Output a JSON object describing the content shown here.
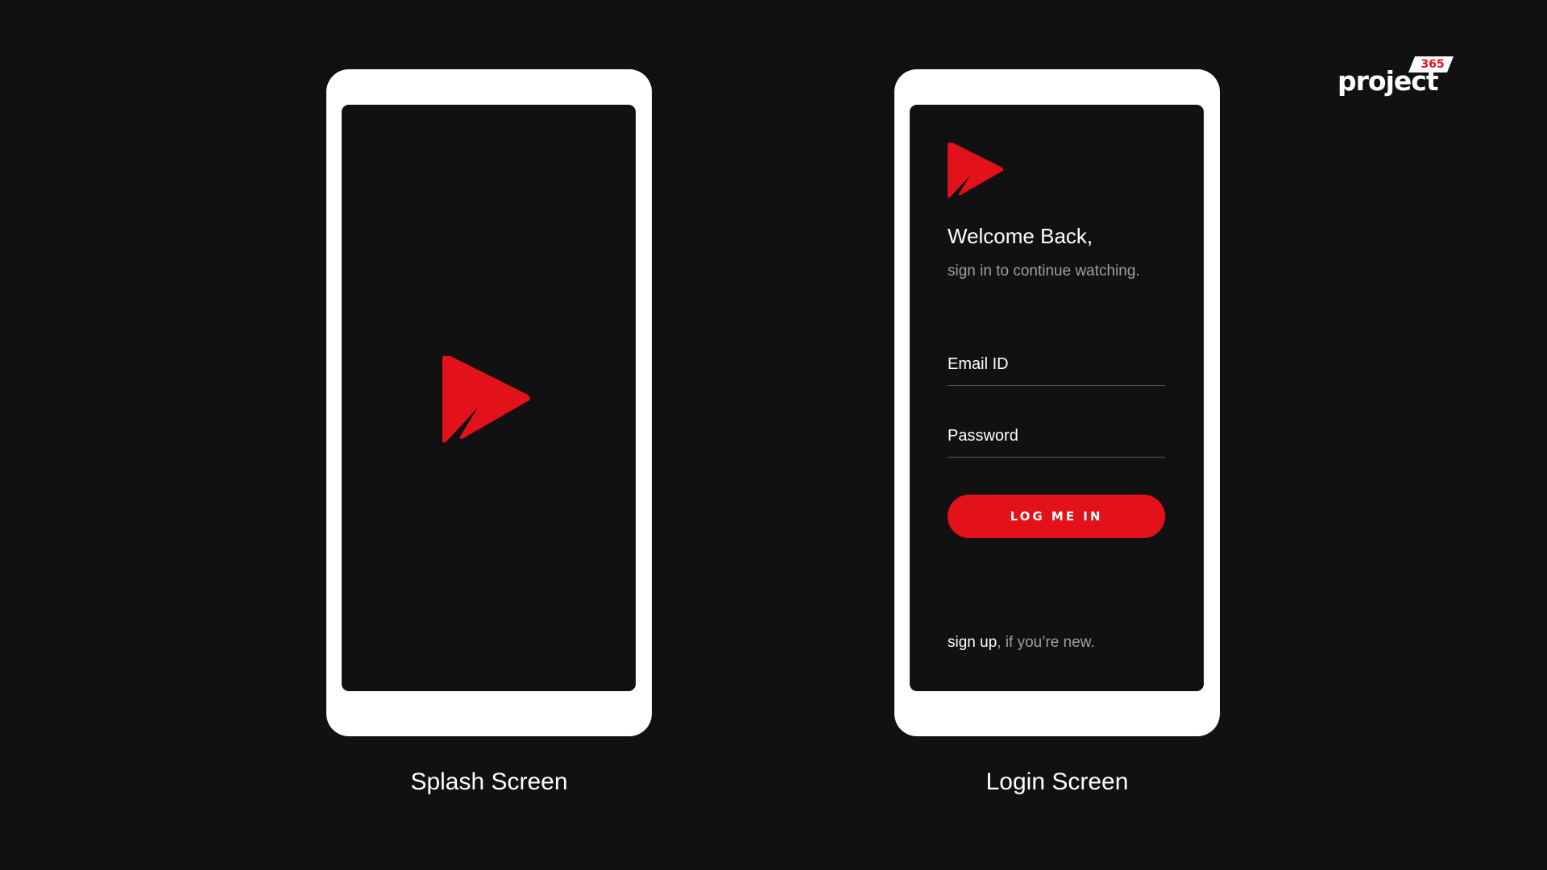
{
  "brand": {
    "name": "project",
    "badge": "365",
    "badge_color": "#e3121a"
  },
  "colors": {
    "background": "#111111",
    "accent": "#e3121a",
    "device_frame": "#ffffff",
    "muted_text": "#a0a0a0"
  },
  "splash": {
    "logo_icon": "play-triangle-logo-icon",
    "caption": "Splash Screen"
  },
  "login": {
    "logo_icon": "play-triangle-logo-icon",
    "title": "Welcome Back,",
    "subtitle": "sign in to continue watching.",
    "email_placeholder": "Email ID",
    "password_placeholder": "Password",
    "button_label": "LOG ME IN",
    "signup_link": "sign up",
    "signup_suffix": ", if you’re new.",
    "caption": "Login Screen"
  }
}
